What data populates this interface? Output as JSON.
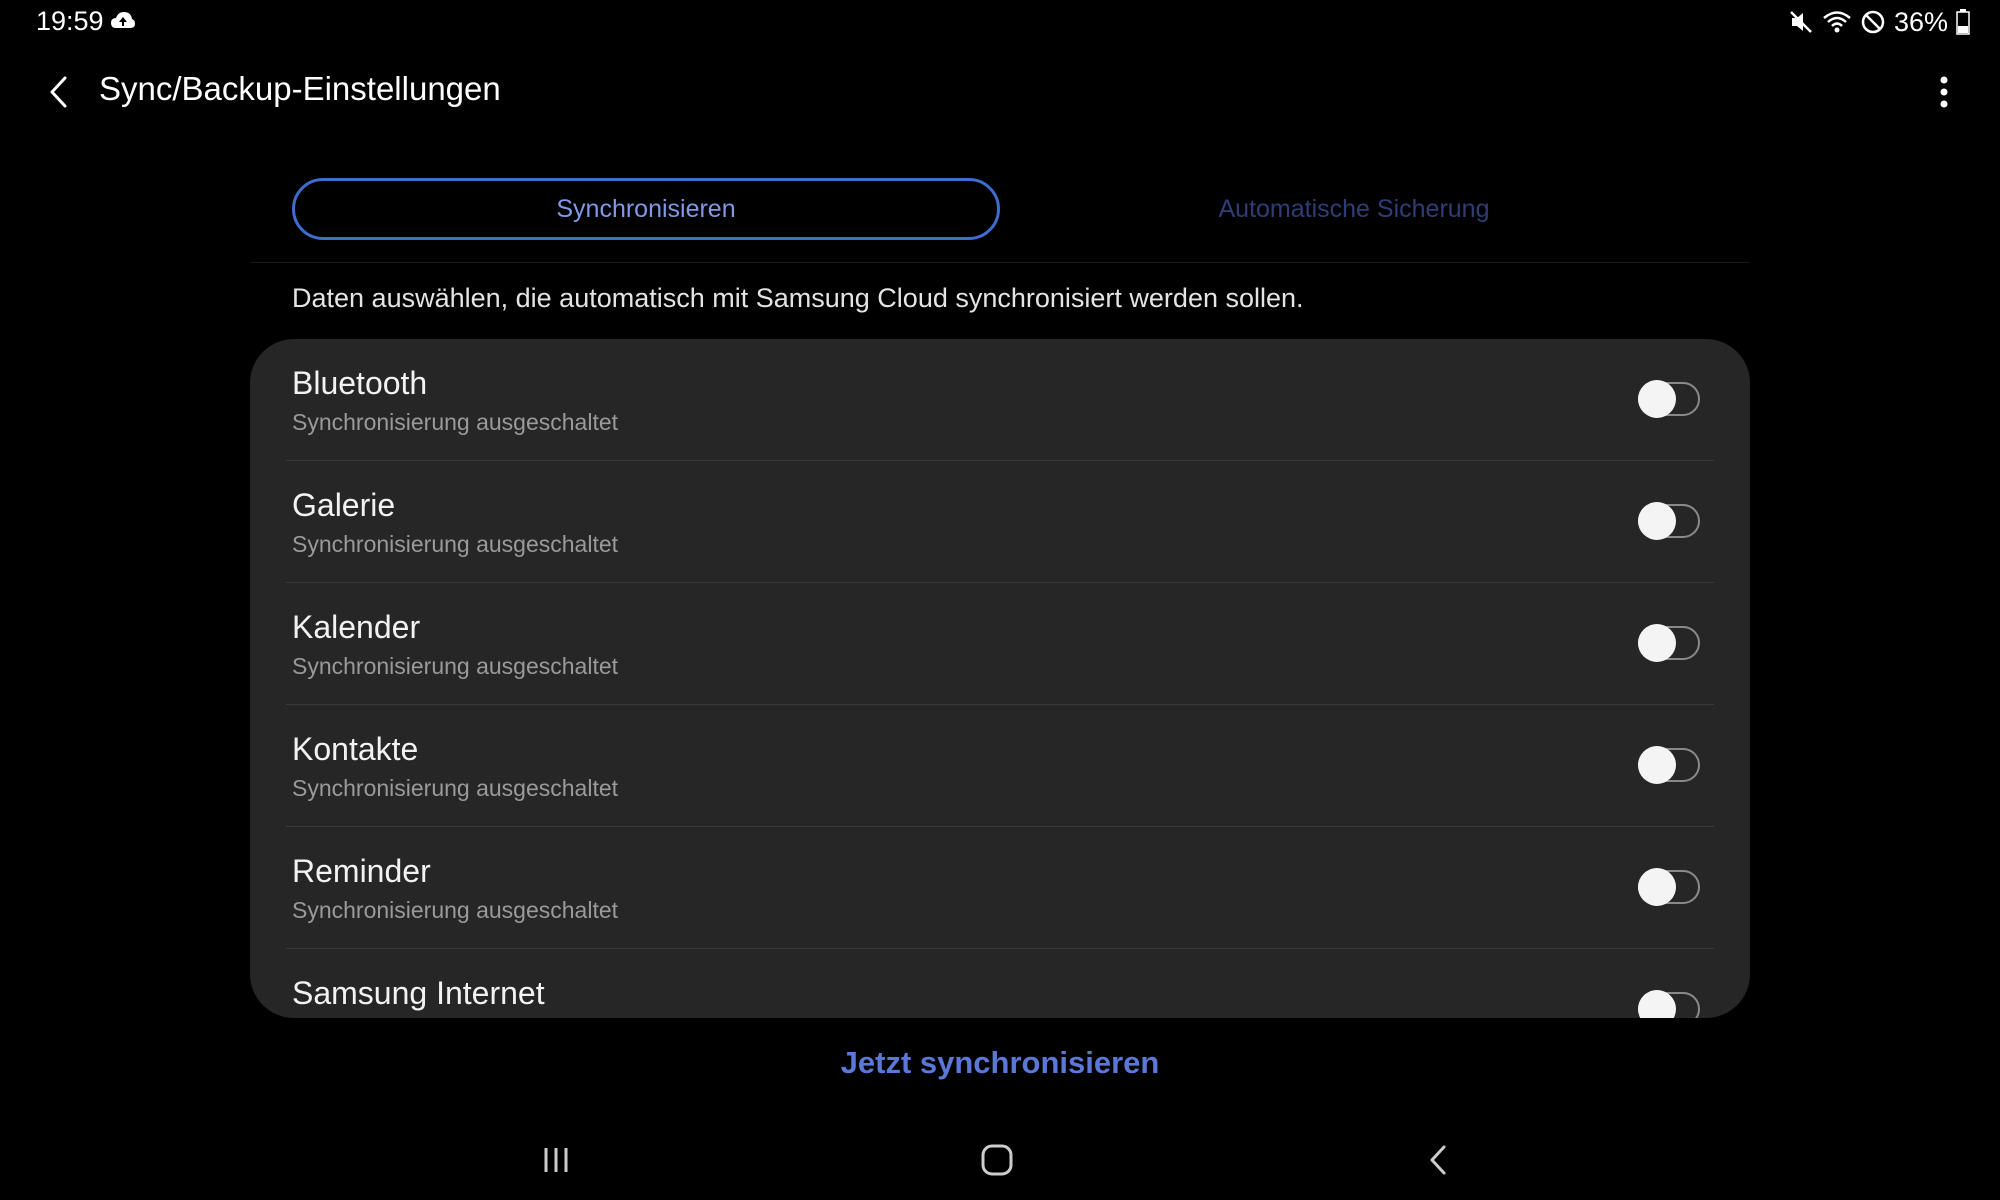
{
  "status_bar": {
    "time": "19:59",
    "battery_percent": "36%",
    "icons": [
      "cloud-sync-icon",
      "mute-icon",
      "wifi-icon",
      "do-not-disturb-icon",
      "battery-icon"
    ],
    "battery_level": 0.36
  },
  "header": {
    "title": "Sync/Backup-Einstellungen",
    "back_icon": "back-arrow-icon",
    "more_icon": "more-options-icon"
  },
  "tabs": [
    {
      "label": "Synchronisieren",
      "selected": true
    },
    {
      "label": "Automatische Sicherung",
      "selected": false
    }
  ],
  "description": "Daten auswählen, die automatisch mit Samsung Cloud synchronisiert werden sollen.",
  "items": [
    {
      "title": "Bluetooth",
      "subtitle": "Synchronisierung ausgeschaltet",
      "enabled": false
    },
    {
      "title": "Galerie",
      "subtitle": "Synchronisierung ausgeschaltet",
      "enabled": false
    },
    {
      "title": "Kalender",
      "subtitle": "Synchronisierung ausgeschaltet",
      "enabled": false
    },
    {
      "title": "Kontakte",
      "subtitle": "Synchronisierung ausgeschaltet",
      "enabled": false
    },
    {
      "title": "Reminder",
      "subtitle": "Synchronisierung ausgeschaltet",
      "enabled": false
    },
    {
      "title": "Samsung Internet",
      "subtitle": "",
      "enabled": false
    }
  ],
  "actions": {
    "sync_now_label": "Jetzt synchronisieren"
  },
  "nav_bar": {
    "icons": [
      "recent-apps-icon",
      "home-icon",
      "nav-back-icon"
    ]
  },
  "colors": {
    "accent": "#3e6ccf",
    "accent_text": "#7f99e8",
    "card_bg": "#262626",
    "background": "#000000"
  }
}
